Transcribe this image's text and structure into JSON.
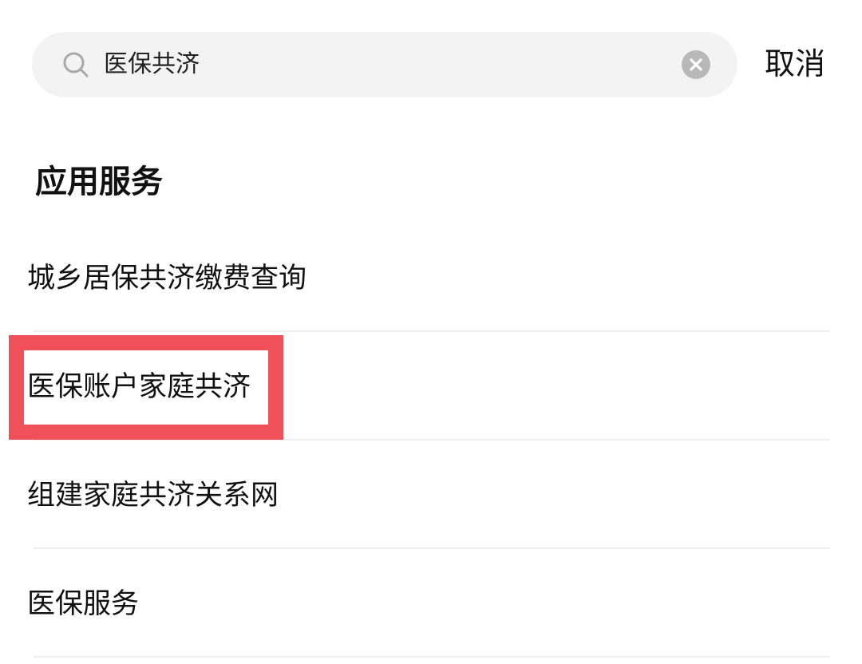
{
  "search": {
    "value": "医保共济",
    "icon": "search-icon",
    "clear_icon": "clear-icon"
  },
  "header": {
    "cancel_label": "取消"
  },
  "section": {
    "title": "应用服务"
  },
  "results": [
    {
      "label": "城乡居保共济缴费查询"
    },
    {
      "label": "医保账户家庭共济"
    },
    {
      "label": "组建家庭共济关系网"
    },
    {
      "label": "医保服务"
    }
  ],
  "colors": {
    "search_background": "#f3f3f3",
    "highlight_border": "#f0505a",
    "divider": "#eeeeee",
    "clear_icon": "#b8b8b8"
  }
}
